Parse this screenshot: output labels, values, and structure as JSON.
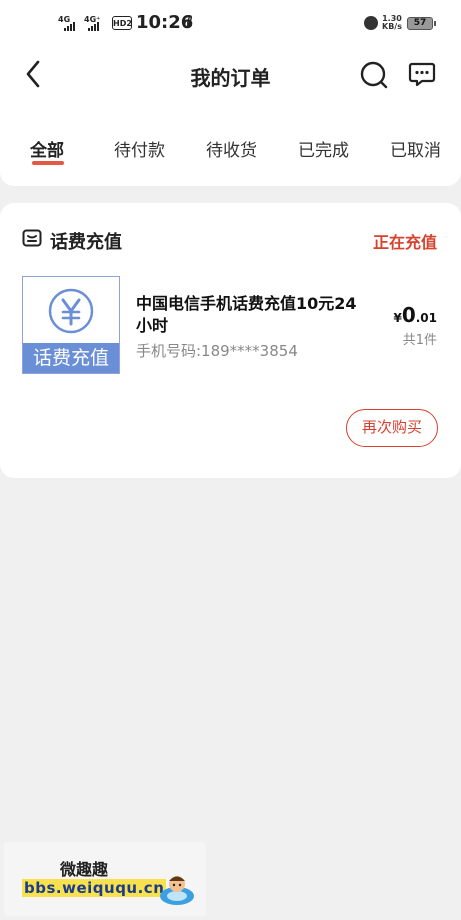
{
  "status_bar": {
    "net1": "4G",
    "net2": "4G⁺",
    "hd": "HD2",
    "time": "10:26",
    "carrier_glyph": "ℓ",
    "speed_value": "1.30",
    "speed_unit": "KB/s",
    "battery": "57"
  },
  "header": {
    "title": "我的订单",
    "back_icon": "chevron-left-icon",
    "search_icon": "search-icon",
    "message_icon": "chat-bubble-icon"
  },
  "tabs": [
    {
      "label": "全部",
      "active": true
    },
    {
      "label": "待付款",
      "active": false
    },
    {
      "label": "待收货",
      "active": false
    },
    {
      "label": "已完成",
      "active": false
    },
    {
      "label": "已取消",
      "active": false
    }
  ],
  "order": {
    "type_label": "话费充值",
    "type_icon": "recharge-icon",
    "status": "正在充值",
    "thumbnail": {
      "band_text": "话费充值",
      "icon": "yuan-coin-icon"
    },
    "product_name": "中国电信手机话费充值10元24小时",
    "phone": "手机号码:189****3854",
    "price": {
      "symbol": "¥",
      "integer": "0",
      "decimal": ".01"
    },
    "quantity": "共1件",
    "rebuy_label": "再次购买"
  },
  "watermark": {
    "title": "微趣趣",
    "url": "bbs.weiququ.cn"
  },
  "colors": {
    "accent": "#d9412f",
    "tab_underline": "#e25a45",
    "thumb_band": "#6b8fd6",
    "background": "#f0f0f0"
  }
}
